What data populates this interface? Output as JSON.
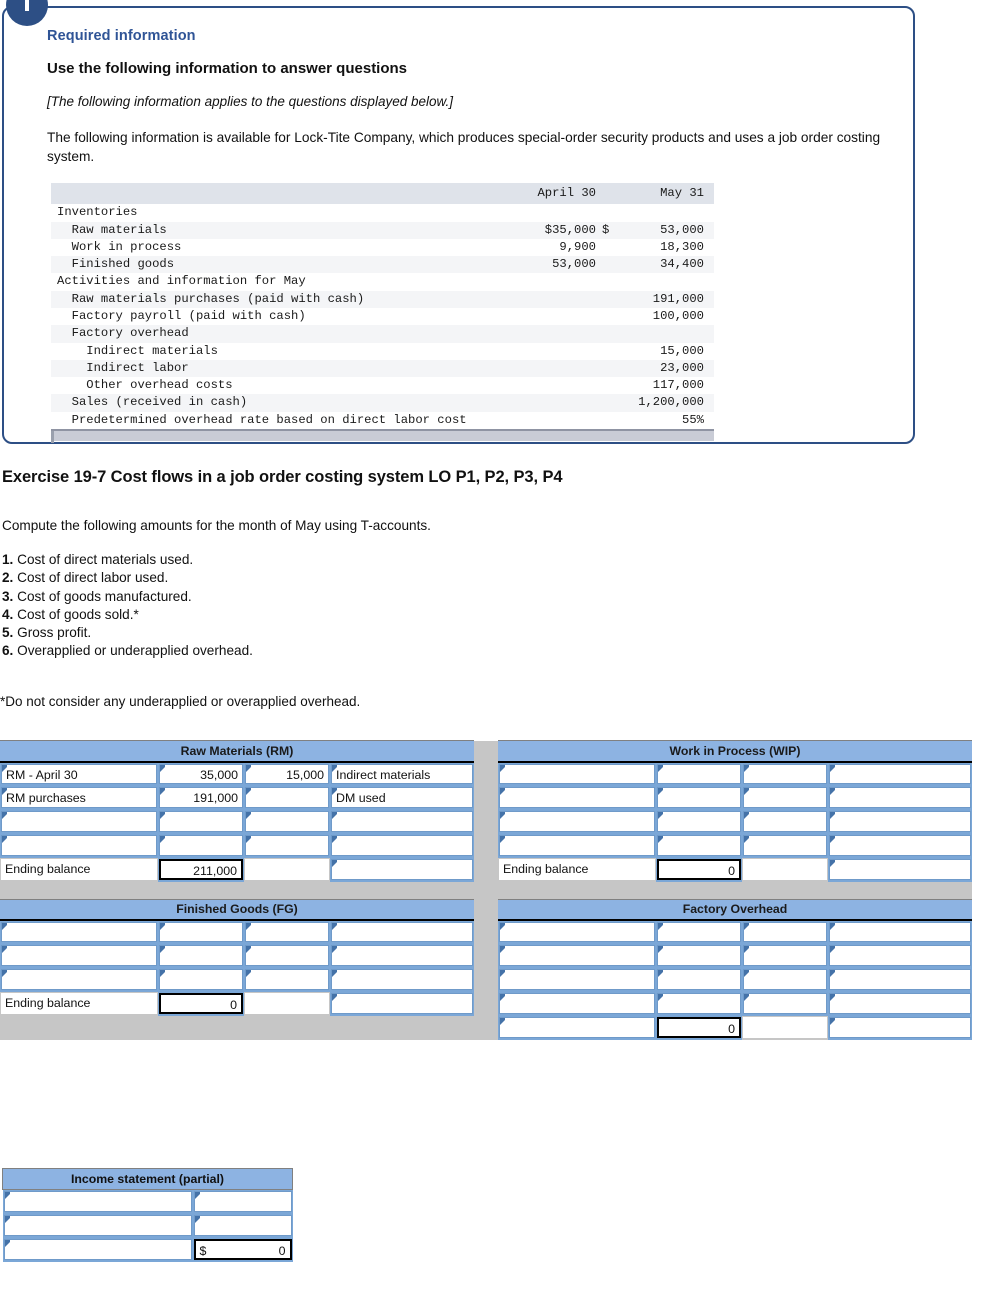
{
  "info_box": {
    "icon": "info-icon",
    "required_label": "Required information",
    "heading": "Use the following information to answer questions",
    "applies_note": "[The following information applies to the questions displayed below.]",
    "lead_paragraph": "The following information is available for Lock-Tite Company, which produces special-order security products and uses a job order costing system.",
    "table": {
      "col_april": "April 30",
      "col_may": "May 31",
      "rows": [
        {
          "label": "Inventories",
          "april": "",
          "dollar": "",
          "may": "",
          "shade": false
        },
        {
          "label": "  Raw materials",
          "april": "$35,000",
          "dollar": "$",
          "may": "53,000",
          "shade": true
        },
        {
          "label": "  Work in process",
          "april": "9,900",
          "dollar": "",
          "may": "18,300",
          "shade": false
        },
        {
          "label": "  Finished goods",
          "april": "53,000",
          "dollar": "",
          "may": "34,400",
          "shade": true
        },
        {
          "label": "Activities and information for May",
          "april": "",
          "dollar": "",
          "may": "",
          "shade": false
        },
        {
          "label": "  Raw materials purchases (paid with cash)",
          "april": "",
          "dollar": "",
          "may": "191,000",
          "shade": true
        },
        {
          "label": "  Factory payroll (paid with cash)",
          "april": "",
          "dollar": "",
          "may": "100,000",
          "shade": false
        },
        {
          "label": "  Factory overhead",
          "april": "",
          "dollar": "",
          "may": "",
          "shade": true
        },
        {
          "label": "    Indirect materials",
          "april": "",
          "dollar": "",
          "may": "15,000",
          "shade": false
        },
        {
          "label": "    Indirect labor",
          "april": "",
          "dollar": "",
          "may": "23,000",
          "shade": true
        },
        {
          "label": "    Other overhead costs",
          "april": "",
          "dollar": "",
          "may": "117,000",
          "shade": false
        },
        {
          "label": "  Sales (received in cash)",
          "april": "",
          "dollar": "",
          "may": "1,200,000",
          "shade": true
        },
        {
          "label": "  Predetermined overhead rate based on direct labor cost",
          "april": "",
          "dollar": "",
          "may": "55%",
          "shade": false
        }
      ]
    }
  },
  "exercise": {
    "title": "Exercise 19-7 Cost flows in a job order costing system LO P1, P2, P3, P4",
    "instruction": "Compute the following amounts for the month of May using T-accounts.",
    "questions": [
      {
        "num": "1.",
        "text": "Cost of direct materials used."
      },
      {
        "num": "2.",
        "text": "Cost of direct labor used."
      },
      {
        "num": "3.",
        "text": "Cost of goods manufactured."
      },
      {
        "num": "4.",
        "text": "Cost of goods sold.*"
      },
      {
        "num": "5.",
        "text": "Gross profit."
      },
      {
        "num": "6.",
        "text": "Overapplied or underapplied overhead."
      }
    ],
    "footnote": "*Do not consider any underapplied or overapplied overhead."
  },
  "taccounts": {
    "rm": {
      "title": "Raw Materials (RM)",
      "rows": [
        {
          "l_label": "RM -  April 30",
          "l_amount": "35,000",
          "r_amount": "15,000",
          "r_label": "Indirect materials"
        },
        {
          "l_label": "RM purchases",
          "l_amount": "191,000",
          "r_amount": "",
          "r_label": "DM used"
        },
        {
          "l_label": "",
          "l_amount": "",
          "r_amount": "",
          "r_label": ""
        },
        {
          "l_label": "",
          "l_amount": "",
          "r_amount": "",
          "r_label": ""
        }
      ],
      "ending_label": "Ending balance",
      "ending_amount": "211,000"
    },
    "wip": {
      "title": "Work in Process (WIP)",
      "rows": [
        {
          "l_label": "",
          "l_amount": "",
          "r_amount": "",
          "r_label": ""
        },
        {
          "l_label": "",
          "l_amount": "",
          "r_amount": "",
          "r_label": ""
        },
        {
          "l_label": "",
          "l_amount": "",
          "r_amount": "",
          "r_label": ""
        },
        {
          "l_label": "",
          "l_amount": "",
          "r_amount": "",
          "r_label": ""
        }
      ],
      "ending_label": "Ending balance",
      "ending_amount": "0"
    },
    "fg": {
      "title": "Finished Goods (FG)",
      "rows": [
        {
          "l_label": "",
          "l_amount": "",
          "r_amount": "",
          "r_label": ""
        },
        {
          "l_label": "",
          "l_amount": "",
          "r_amount": "",
          "r_label": ""
        },
        {
          "l_label": "",
          "l_amount": "",
          "r_amount": "",
          "r_label": ""
        }
      ],
      "ending_label": "Ending balance",
      "ending_amount": "0"
    },
    "fo": {
      "title": "Factory Overhead",
      "rows": [
        {
          "l_label": "",
          "l_amount": "",
          "r_amount": "",
          "r_label": ""
        },
        {
          "l_label": "",
          "l_amount": "",
          "r_amount": "",
          "r_label": ""
        },
        {
          "l_label": "",
          "l_amount": "",
          "r_amount": "",
          "r_label": ""
        },
        {
          "l_label": "",
          "l_amount": "",
          "r_amount": "",
          "r_label": ""
        }
      ],
      "ending_label": "",
      "ending_amount": "0"
    }
  },
  "income_statement": {
    "title": "Income statement (partial)",
    "rows": [
      {
        "label": "",
        "currency": "",
        "amount": ""
      },
      {
        "label": "",
        "currency": "",
        "amount": ""
      },
      {
        "label": "",
        "currency": "$",
        "amount": "0"
      }
    ]
  },
  "colors": {
    "header_blue": "#8db3e2",
    "box_border": "#2d4f85",
    "required_text": "#2f5496",
    "grid_grey": "#c6c6c6"
  }
}
